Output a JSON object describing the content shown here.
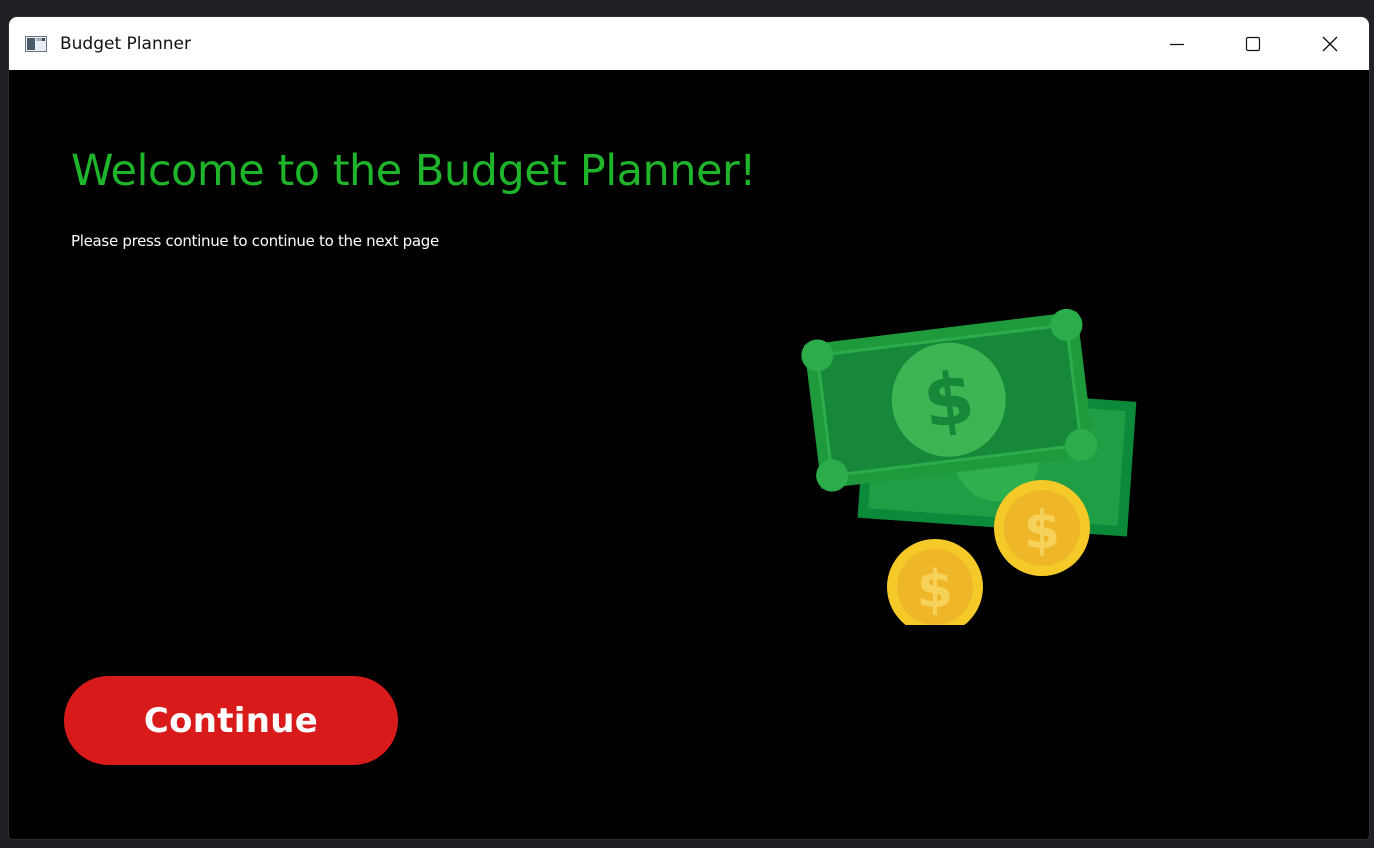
{
  "window": {
    "title": "Budget Planner",
    "controls": {
      "minimize": "minimize-icon",
      "maximize": "maximize-icon",
      "close": "close-icon"
    }
  },
  "main": {
    "heading": "Welcome to the Budget Planner!",
    "subtitle": "Please press continue to continue to the next page",
    "illustration": "money-bills-and-coins-illustration",
    "continue_label": "Continue"
  },
  "colors": {
    "heading": "#1fb52b",
    "background": "#000000",
    "button": "#d91a1a",
    "button_text": "#ffffff",
    "bill_green": "#1e9a3c",
    "coin_gold": "#f5c928"
  }
}
